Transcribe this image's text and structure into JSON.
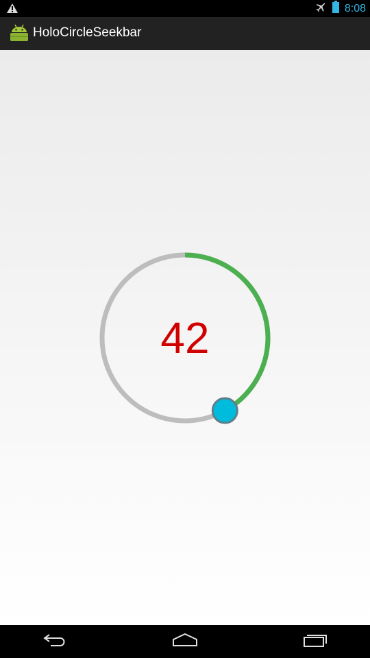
{
  "status_bar": {
    "time": "8:08",
    "icons": [
      "warning-icon",
      "airplane-icon",
      "battery-icon"
    ],
    "accent_color": "#33b5e5"
  },
  "action_bar": {
    "title": "HoloCircleSeekbar",
    "icon": "android-icon"
  },
  "seekbar": {
    "value": 42,
    "max": 100,
    "value_text": "42",
    "progress_color": "#4caf50",
    "track_color": "#bdbdbd",
    "thumb_color": "#00bcdc",
    "text_color": "#d10000"
  },
  "nav_bar": {
    "buttons": [
      "back-icon",
      "home-icon",
      "recents-icon"
    ]
  }
}
